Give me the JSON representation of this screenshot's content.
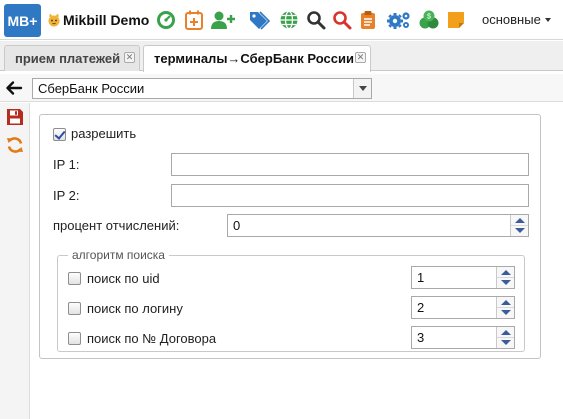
{
  "app": {
    "logo": "MB+",
    "title": "Mikbill Demo",
    "menu_selector": "основные"
  },
  "toolbar_icons": [
    "dashboard-icon",
    "calendar-add-icon",
    "add-user-icon",
    "tags-icon",
    "globe-icon",
    "search-icon",
    "search-red-icon",
    "clipboard-icon",
    "settings-gears-icon",
    "money-icon",
    "sticky-note-icon"
  ],
  "tabs": [
    {
      "label": "прием платежей",
      "active": false
    },
    {
      "label": "терминалы→СберБанк России",
      "active": true
    }
  ],
  "record_select": {
    "value": "СберБанк России"
  },
  "form": {
    "allow": {
      "label": "разрешить",
      "checked": true
    },
    "ip1": {
      "label": "IP 1:",
      "value": ""
    },
    "ip2": {
      "label": "IP 2:",
      "value": ""
    },
    "percent": {
      "label": "процент отчислений:",
      "value": "0"
    },
    "search_group": {
      "legend": "алгоритм поиска",
      "items": [
        {
          "label": "поиск по uid",
          "checked": false,
          "value": "1"
        },
        {
          "label": "поиск по логину",
          "checked": false,
          "value": "2"
        },
        {
          "label": "поиск по № Договора",
          "checked": false,
          "value": "3"
        }
      ]
    }
  },
  "colors": {
    "logo_bg": "#2f78c4",
    "accent_blue": "#2f78c4",
    "save_red": "#b52d1f",
    "refresh_orange": "#e07b1a"
  }
}
